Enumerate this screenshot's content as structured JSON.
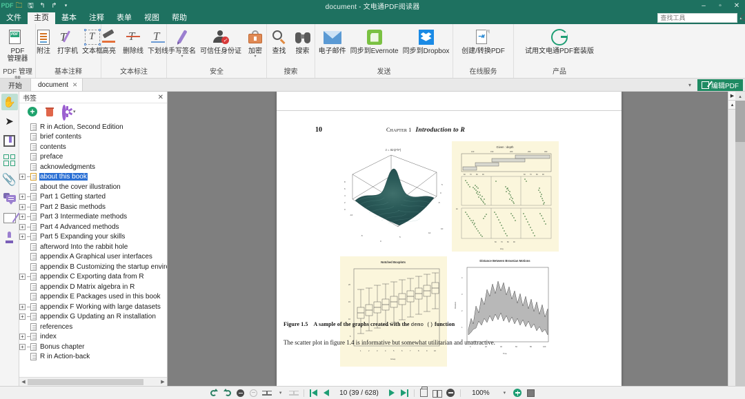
{
  "window": {
    "title": "document - 文电通PDF阅读器",
    "quick_access": [
      "pdf-icon",
      "open-icon",
      "save-icon",
      "undo-icon",
      "redo-icon",
      "more-icon"
    ],
    "controls": {
      "minimize": "–",
      "maximize": "▫",
      "close": "✕"
    }
  },
  "ribbon": {
    "tabs": [
      {
        "label": "文件",
        "active": false
      },
      {
        "label": "主页",
        "active": true
      },
      {
        "label": "基本",
        "active": false
      },
      {
        "label": "注释",
        "active": false
      },
      {
        "label": "表单",
        "active": false
      },
      {
        "label": "视图",
        "active": false
      },
      {
        "label": "帮助",
        "active": false
      }
    ],
    "search": {
      "placeholder": "查找工具",
      "value": ""
    },
    "groups": [
      {
        "label": "PDF 管理器",
        "items": [
          {
            "label_line1": "PDF",
            "label_line2": "管理器",
            "icon": "pdf-manager-icon",
            "caret": false
          }
        ]
      },
      {
        "label": "基本注释",
        "items": [
          {
            "label_line1": "附注",
            "label_line2": "",
            "icon": "sticky-note-icon",
            "caret": false
          },
          {
            "label_line1": "打字机",
            "label_line2": "",
            "icon": "typewriter-icon",
            "caret": false
          },
          {
            "label_line1": "文本框",
            "label_line2": "",
            "icon": "textbox-icon",
            "caret": false
          }
        ]
      },
      {
        "label": "文本标注",
        "items": [
          {
            "label_line1": "高亮",
            "label_line2": "",
            "icon": "highlight-icon",
            "caret": false
          },
          {
            "label_line1": "删除线",
            "label_line2": "",
            "icon": "strikethrough-icon",
            "caret": false
          },
          {
            "label_line1": "下划线",
            "label_line2": "",
            "icon": "underline-icon",
            "caret": false
          }
        ]
      },
      {
        "label": "安全",
        "items": [
          {
            "label_line1": "手写签名",
            "label_line2": "",
            "icon": "signature-icon",
            "caret": true
          },
          {
            "label_line1": "可信任身份证",
            "label_line2": "",
            "icon": "trusted-id-icon",
            "caret": false
          },
          {
            "label_line1": "加密",
            "label_line2": "",
            "icon": "encrypt-icon",
            "caret": true
          }
        ]
      },
      {
        "label": "搜索",
        "items": [
          {
            "label_line1": "查找",
            "label_line2": "",
            "icon": "find-icon",
            "caret": false
          },
          {
            "label_line1": "搜索",
            "label_line2": "",
            "icon": "binoculars-icon",
            "caret": false
          }
        ]
      },
      {
        "label": "发送",
        "items": [
          {
            "label_line1": "电子邮件",
            "label_line2": "",
            "icon": "email-icon",
            "caret": false
          },
          {
            "label_line1": "同步到Evernote",
            "label_line2": "",
            "icon": "evernote-icon",
            "caret": false
          },
          {
            "label_line1": "同步到Dropbox",
            "label_line2": "",
            "icon": "dropbox-icon",
            "caret": false
          }
        ]
      },
      {
        "label": "在线服务",
        "items": [
          {
            "label_line1": "创建/转换PDF",
            "label_line2": "",
            "icon": "create-convert-pdf-icon",
            "caret": false
          }
        ]
      },
      {
        "label": "产品",
        "items": [
          {
            "label_line1": "试用文电通PDF套装版",
            "label_line2": "",
            "icon": "gaaiho-logo-icon",
            "caret": false
          }
        ]
      }
    ]
  },
  "tabstrip": {
    "home_label": "开始",
    "doc_tab": {
      "label": "document",
      "close": "✕"
    },
    "overflow_caret": "▾",
    "edit_pdf_button": "编辑PDF"
  },
  "toolstrip": {
    "items": [
      {
        "name": "hand-tool",
        "selected": true
      },
      {
        "name": "select-tool",
        "selected": false
      },
      {
        "name": "bookmark-panel-toggle",
        "selected": false
      },
      {
        "name": "thumbnails-panel-toggle",
        "selected": false
      },
      {
        "name": "attachments-panel-toggle",
        "selected": false
      },
      {
        "name": "comments-panel-toggle",
        "selected": false
      },
      {
        "name": "signature-panel-toggle",
        "selected": false
      },
      {
        "name": "stamps-panel-toggle",
        "selected": false
      }
    ]
  },
  "bookmarks": {
    "title": "书签",
    "close": "✕",
    "toolbar": {
      "add": "add-bookmark",
      "delete": "delete-bookmark",
      "options": "bookmark-options",
      "caret": "▾"
    },
    "items": [
      {
        "label": "R in Action, Second Edition",
        "expandable": false,
        "selected": false
      },
      {
        "label": "brief contents",
        "expandable": false,
        "selected": false
      },
      {
        "label": "contents",
        "expandable": false,
        "selected": false
      },
      {
        "label": "preface",
        "expandable": false,
        "selected": false
      },
      {
        "label": "acknowledgments",
        "expandable": false,
        "selected": false
      },
      {
        "label": "about this book",
        "expandable": true,
        "selected": true
      },
      {
        "label": "about the cover illustration",
        "expandable": false,
        "selected": false
      },
      {
        "label": "Part 1 Getting started",
        "expandable": true,
        "selected": false
      },
      {
        "label": "Part 2 Basic methods",
        "expandable": true,
        "selected": false
      },
      {
        "label": "Part 3 Intermediate methods",
        "expandable": true,
        "selected": false
      },
      {
        "label": "Part 4 Advanced methods",
        "expandable": true,
        "selected": false
      },
      {
        "label": "Part 5 Expanding your skills",
        "expandable": true,
        "selected": false
      },
      {
        "label": "afterword Into the rabbit hole",
        "expandable": false,
        "selected": false
      },
      {
        "label": "appendix A Graphical user interfaces",
        "expandable": false,
        "selected": false
      },
      {
        "label": "appendix B Customizing the startup environme",
        "expandable": false,
        "selected": false
      },
      {
        "label": "appendix C Exporting data from R",
        "expandable": true,
        "selected": false
      },
      {
        "label": "appendix D Matrix algebra in R",
        "expandable": false,
        "selected": false
      },
      {
        "label": "appendix E Packages used in this book",
        "expandable": false,
        "selected": false
      },
      {
        "label": "appendix F Working with large datasets",
        "expandable": true,
        "selected": false
      },
      {
        "label": "appendix G Updating an R installation",
        "expandable": true,
        "selected": false
      },
      {
        "label": "references",
        "expandable": false,
        "selected": false
      },
      {
        "label": "index",
        "expandable": true,
        "selected": false
      },
      {
        "label": "Bonus chapter",
        "expandable": true,
        "selected": false
      },
      {
        "label": "R in Action-back",
        "expandable": false,
        "selected": false
      }
    ]
  },
  "document": {
    "page_number": "10",
    "chapter_label": "Chapter 1",
    "chapter_title": "Introduction to R",
    "figures": [
      {
        "name": "persp-3d-surface",
        "title": "z = Sin(r²/r²)",
        "background": "#ffffff"
      },
      {
        "name": "lattice-depth-panels",
        "title": "Given : depth",
        "background": "#fbf6dc"
      },
      {
        "name": "notched-boxplots",
        "title": "Notched Boxplots",
        "background": "#fbf6dc"
      },
      {
        "name": "brownian-motion",
        "title": "Distance Between Brownian Motions",
        "background": "#ffffff"
      }
    ],
    "caption_prefix": "Figure 1.5",
    "caption_text": "A sample of the graphs created with the",
    "caption_code": "demo ()",
    "caption_suffix": "function",
    "body_text": "The scatter plot in figure 1.4 is informative but somewhat utilitarian and unattractive."
  },
  "statusbar": {
    "page_indicator": "10 (39 / 628)",
    "zoom_level": "100%",
    "zoom_caret": "▾",
    "layout_caret": "▾",
    "buttons": [
      {
        "name": "rotate-left-button"
      },
      {
        "name": "rotate-right-button"
      },
      {
        "name": "collapse-button"
      },
      {
        "name": "expand-button-disabled"
      },
      {
        "name": "fit-width-button"
      },
      {
        "name": "fit-caret"
      },
      {
        "name": "fit-page-button-disabled"
      },
      {
        "name": "first-page-button"
      },
      {
        "name": "previous-page-button"
      },
      {
        "name": "next-page-button"
      },
      {
        "name": "last-page-button"
      },
      {
        "name": "single-page-view-button"
      },
      {
        "name": "two-page-view-button"
      },
      {
        "name": "zoom-out-button"
      },
      {
        "name": "zoom-in-button"
      },
      {
        "name": "zoom-select-button"
      }
    ]
  }
}
